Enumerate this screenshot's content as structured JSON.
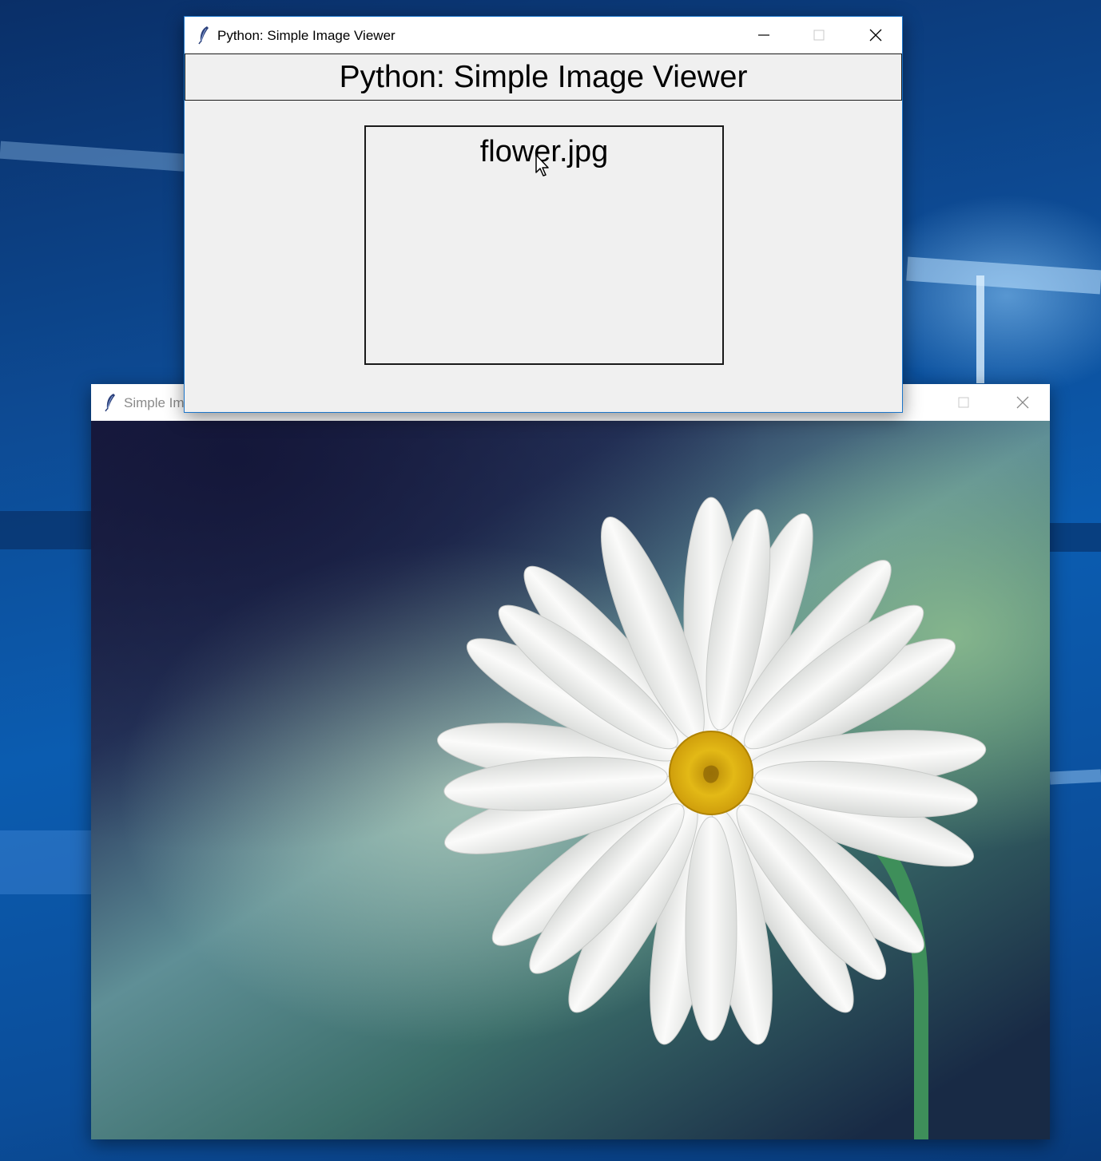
{
  "desktop": {
    "accent_color": "#0b5cb0"
  },
  "image_window": {
    "title": "Simple Im",
    "icon": "feather-icon",
    "image_description_colors": {
      "petal": "#f4f4f2",
      "center": "#e3b916",
      "stem": "#3e8f5a",
      "background_dark": "#14193a",
      "background_light": "#8fc0a8"
    }
  },
  "viewer_window": {
    "title": "Python: Simple Image Viewer",
    "icon": "feather-icon",
    "header_label": "Python: Simple Image Viewer",
    "files": [
      "flower.jpg"
    ],
    "window_border_color": "#1c75c9"
  }
}
